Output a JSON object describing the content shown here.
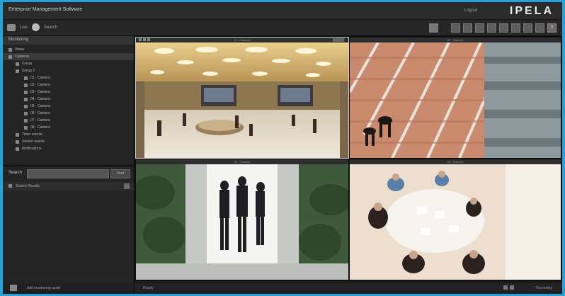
{
  "window": {
    "title": "Enterprise Management Software",
    "login": "Logout",
    "brand": "IPELA"
  },
  "toolbar": {
    "left_label_1": "Live",
    "left_label_2": "Search"
  },
  "sidebar": {
    "tree_header": "Monitoring",
    "tree": [
      {
        "label": "Views",
        "level": 0
      },
      {
        "label": "Cameras",
        "level": 0,
        "highlight": true
      },
      {
        "label": "Group",
        "level": 1
      },
      {
        "label": "Group 2",
        "level": 1
      },
      {
        "label": "01 - Camera",
        "level": 2
      },
      {
        "label": "02 - Camera",
        "level": 2
      },
      {
        "label": "03 - Camera",
        "level": 2
      },
      {
        "label": "04 - Camera",
        "level": 2
      },
      {
        "label": "05 - Camera",
        "level": 2
      },
      {
        "label": "06 - Camera",
        "level": 2
      },
      {
        "label": "07 - Camera",
        "level": 2
      },
      {
        "label": "08 - Camera",
        "level": 2
      },
      {
        "label": "Timer events",
        "level": 1
      },
      {
        "label": "Sensor events",
        "level": 1
      },
      {
        "label": "Notifications",
        "level": 1
      }
    ],
    "search_label": "Search",
    "search_button": "Find",
    "results_label": "Search Results",
    "footer_label": "Add monitoring panel"
  },
  "video": {
    "cameras": [
      "01 - Camera",
      "02 - Camera",
      "03 - Camera",
      "04 - Camera"
    ]
  },
  "status": {
    "left": "Ready",
    "right": "Recording"
  }
}
